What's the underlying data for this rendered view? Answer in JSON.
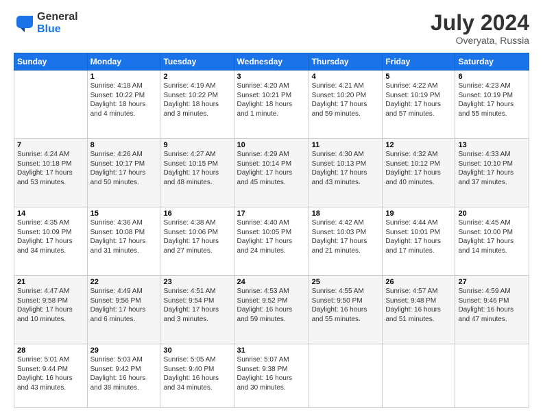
{
  "header": {
    "logo_general": "General",
    "logo_blue": "Blue",
    "month_year": "July 2024",
    "location": "Overyata, Russia"
  },
  "days_of_week": [
    "Sunday",
    "Monday",
    "Tuesday",
    "Wednesday",
    "Thursday",
    "Friday",
    "Saturday"
  ],
  "weeks": [
    [
      {
        "day": "",
        "sunrise": "",
        "sunset": "",
        "daylight": ""
      },
      {
        "day": "1",
        "sunrise": "Sunrise: 4:18 AM",
        "sunset": "Sunset: 10:22 PM",
        "daylight": "Daylight: 18 hours and 4 minutes."
      },
      {
        "day": "2",
        "sunrise": "Sunrise: 4:19 AM",
        "sunset": "Sunset: 10:22 PM",
        "daylight": "Daylight: 18 hours and 3 minutes."
      },
      {
        "day": "3",
        "sunrise": "Sunrise: 4:20 AM",
        "sunset": "Sunset: 10:21 PM",
        "daylight": "Daylight: 18 hours and 1 minute."
      },
      {
        "day": "4",
        "sunrise": "Sunrise: 4:21 AM",
        "sunset": "Sunset: 10:20 PM",
        "daylight": "Daylight: 17 hours and 59 minutes."
      },
      {
        "day": "5",
        "sunrise": "Sunrise: 4:22 AM",
        "sunset": "Sunset: 10:19 PM",
        "daylight": "Daylight: 17 hours and 57 minutes."
      },
      {
        "day": "6",
        "sunrise": "Sunrise: 4:23 AM",
        "sunset": "Sunset: 10:19 PM",
        "daylight": "Daylight: 17 hours and 55 minutes."
      }
    ],
    [
      {
        "day": "7",
        "sunrise": "Sunrise: 4:24 AM",
        "sunset": "Sunset: 10:18 PM",
        "daylight": "Daylight: 17 hours and 53 minutes."
      },
      {
        "day": "8",
        "sunrise": "Sunrise: 4:26 AM",
        "sunset": "Sunset: 10:17 PM",
        "daylight": "Daylight: 17 hours and 50 minutes."
      },
      {
        "day": "9",
        "sunrise": "Sunrise: 4:27 AM",
        "sunset": "Sunset: 10:15 PM",
        "daylight": "Daylight: 17 hours and 48 minutes."
      },
      {
        "day": "10",
        "sunrise": "Sunrise: 4:29 AM",
        "sunset": "Sunset: 10:14 PM",
        "daylight": "Daylight: 17 hours and 45 minutes."
      },
      {
        "day": "11",
        "sunrise": "Sunrise: 4:30 AM",
        "sunset": "Sunset: 10:13 PM",
        "daylight": "Daylight: 17 hours and 43 minutes."
      },
      {
        "day": "12",
        "sunrise": "Sunrise: 4:32 AM",
        "sunset": "Sunset: 10:12 PM",
        "daylight": "Daylight: 17 hours and 40 minutes."
      },
      {
        "day": "13",
        "sunrise": "Sunrise: 4:33 AM",
        "sunset": "Sunset: 10:10 PM",
        "daylight": "Daylight: 17 hours and 37 minutes."
      }
    ],
    [
      {
        "day": "14",
        "sunrise": "Sunrise: 4:35 AM",
        "sunset": "Sunset: 10:09 PM",
        "daylight": "Daylight: 17 hours and 34 minutes."
      },
      {
        "day": "15",
        "sunrise": "Sunrise: 4:36 AM",
        "sunset": "Sunset: 10:08 PM",
        "daylight": "Daylight: 17 hours and 31 minutes."
      },
      {
        "day": "16",
        "sunrise": "Sunrise: 4:38 AM",
        "sunset": "Sunset: 10:06 PM",
        "daylight": "Daylight: 17 hours and 27 minutes."
      },
      {
        "day": "17",
        "sunrise": "Sunrise: 4:40 AM",
        "sunset": "Sunset: 10:05 PM",
        "daylight": "Daylight: 17 hours and 24 minutes."
      },
      {
        "day": "18",
        "sunrise": "Sunrise: 4:42 AM",
        "sunset": "Sunset: 10:03 PM",
        "daylight": "Daylight: 17 hours and 21 minutes."
      },
      {
        "day": "19",
        "sunrise": "Sunrise: 4:44 AM",
        "sunset": "Sunset: 10:01 PM",
        "daylight": "Daylight: 17 hours and 17 minutes."
      },
      {
        "day": "20",
        "sunrise": "Sunrise: 4:45 AM",
        "sunset": "Sunset: 10:00 PM",
        "daylight": "Daylight: 17 hours and 14 minutes."
      }
    ],
    [
      {
        "day": "21",
        "sunrise": "Sunrise: 4:47 AM",
        "sunset": "Sunset: 9:58 PM",
        "daylight": "Daylight: 17 hours and 10 minutes."
      },
      {
        "day": "22",
        "sunrise": "Sunrise: 4:49 AM",
        "sunset": "Sunset: 9:56 PM",
        "daylight": "Daylight: 17 hours and 6 minutes."
      },
      {
        "day": "23",
        "sunrise": "Sunrise: 4:51 AM",
        "sunset": "Sunset: 9:54 PM",
        "daylight": "Daylight: 17 hours and 3 minutes."
      },
      {
        "day": "24",
        "sunrise": "Sunrise: 4:53 AM",
        "sunset": "Sunset: 9:52 PM",
        "daylight": "Daylight: 16 hours and 59 minutes."
      },
      {
        "day": "25",
        "sunrise": "Sunrise: 4:55 AM",
        "sunset": "Sunset: 9:50 PM",
        "daylight": "Daylight: 16 hours and 55 minutes."
      },
      {
        "day": "26",
        "sunrise": "Sunrise: 4:57 AM",
        "sunset": "Sunset: 9:48 PM",
        "daylight": "Daylight: 16 hours and 51 minutes."
      },
      {
        "day": "27",
        "sunrise": "Sunrise: 4:59 AM",
        "sunset": "Sunset: 9:46 PM",
        "daylight": "Daylight: 16 hours and 47 minutes."
      }
    ],
    [
      {
        "day": "28",
        "sunrise": "Sunrise: 5:01 AM",
        "sunset": "Sunset: 9:44 PM",
        "daylight": "Daylight: 16 hours and 43 minutes."
      },
      {
        "day": "29",
        "sunrise": "Sunrise: 5:03 AM",
        "sunset": "Sunset: 9:42 PM",
        "daylight": "Daylight: 16 hours and 38 minutes."
      },
      {
        "day": "30",
        "sunrise": "Sunrise: 5:05 AM",
        "sunset": "Sunset: 9:40 PM",
        "daylight": "Daylight: 16 hours and 34 minutes."
      },
      {
        "day": "31",
        "sunrise": "Sunrise: 5:07 AM",
        "sunset": "Sunset: 9:38 PM",
        "daylight": "Daylight: 16 hours and 30 minutes."
      },
      {
        "day": "",
        "sunrise": "",
        "sunset": "",
        "daylight": ""
      },
      {
        "day": "",
        "sunrise": "",
        "sunset": "",
        "daylight": ""
      },
      {
        "day": "",
        "sunrise": "",
        "sunset": "",
        "daylight": ""
      }
    ]
  ]
}
